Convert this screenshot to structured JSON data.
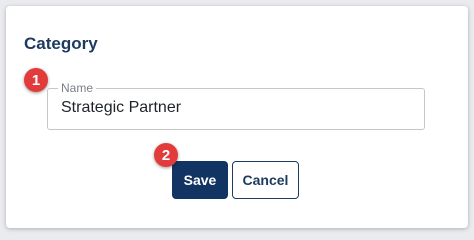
{
  "dialog": {
    "title": "Category",
    "name_field": {
      "label": "Name",
      "value": "Strategic Partner"
    },
    "buttons": {
      "save_label": "Save",
      "cancel_label": "Cancel"
    }
  },
  "annotations": {
    "step_1": "1",
    "step_2": "2"
  },
  "colors": {
    "primary": "#113463",
    "badge": "#e23b3b",
    "title": "#1d3a5f"
  }
}
